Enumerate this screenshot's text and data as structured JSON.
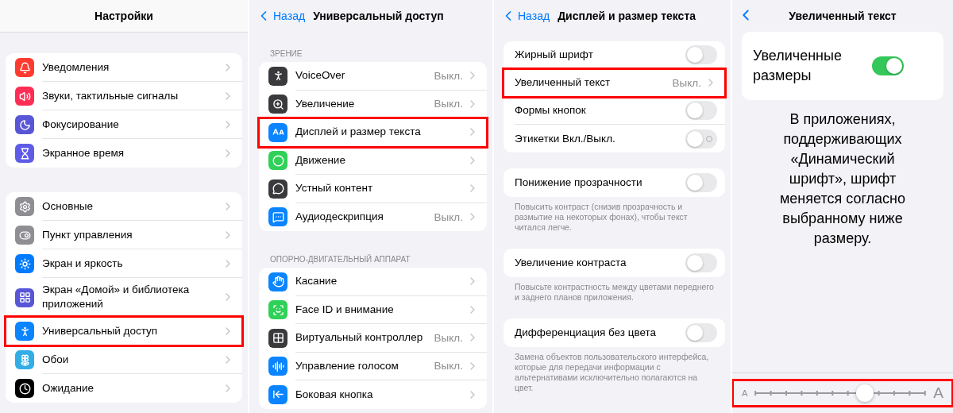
{
  "panels": [
    {
      "kind": "list",
      "title": "Настройки",
      "groups": [
        {
          "items": [
            {
              "kind": "nav",
              "label": "Уведомления",
              "color": "#ff3b30",
              "highlighted": false
            },
            {
              "kind": "nav",
              "label": "Звуки, тактильные сигналы",
              "color": "#ff2d55",
              "highlighted": false
            },
            {
              "kind": "nav",
              "label": "Фокусирование",
              "color": "#5856d6",
              "highlighted": false
            },
            {
              "kind": "nav",
              "label": "Экранное время",
              "color": "#5e5ce6",
              "highlighted": false
            }
          ]
        },
        {
          "items": [
            {
              "kind": "nav",
              "label": "Основные",
              "color": "#8e8e93",
              "highlighted": false
            },
            {
              "kind": "nav",
              "label": "Пункт управления",
              "color": "#8e8e93",
              "highlighted": false
            },
            {
              "kind": "nav",
              "label": "Экран и яркость",
              "color": "#007aff",
              "highlighted": false
            },
            {
              "kind": "nav",
              "label": "Экран «Домой» и библиотека приложений",
              "color": "#5856d6",
              "highlighted": false
            },
            {
              "kind": "nav",
              "label": "Универсальный доступ",
              "color": "#0a84ff",
              "highlighted": true
            },
            {
              "kind": "nav",
              "label": "Обои",
              "color": "#32ade6",
              "highlighted": false
            },
            {
              "kind": "nav",
              "label": "Ожидание",
              "color": "#000000",
              "highlighted": false
            }
          ]
        }
      ]
    },
    {
      "kind": "list",
      "back": "Назад",
      "title": "Универсальный доступ",
      "groups": [
        {
          "header": "ЗРЕНИЕ",
          "items": [
            {
              "kind": "nav",
              "label": "VoiceOver",
              "value": "Выкл.",
              "color": "#3a3a3c",
              "highlighted": false
            },
            {
              "kind": "nav",
              "label": "Увеличение",
              "value": "Выкл.",
              "color": "#3a3a3c",
              "highlighted": false
            },
            {
              "kind": "nav",
              "label": "Дисплей и размер текста",
              "color": "#0a84ff",
              "highlighted": true
            },
            {
              "kind": "nav",
              "label": "Движение",
              "color": "#30d158",
              "highlighted": false
            },
            {
              "kind": "nav",
              "label": "Устный контент",
              "color": "#3a3a3c",
              "highlighted": false
            },
            {
              "kind": "nav",
              "label": "Аудиодескрипция",
              "value": "Выкл.",
              "color": "#0a84ff",
              "highlighted": false
            }
          ]
        },
        {
          "header": "ОПОРНО-ДВИГАТЕЛЬНЫЙ АППАРАТ",
          "items": [
            {
              "kind": "nav",
              "label": "Касание",
              "color": "#0a84ff",
              "highlighted": false
            },
            {
              "kind": "nav",
              "label": "Face ID и внимание",
              "color": "#30d158",
              "highlighted": false
            },
            {
              "kind": "nav",
              "label": "Виртуальный контроллер",
              "value": "Выкл.",
              "color": "#3a3a3c",
              "highlighted": false
            },
            {
              "kind": "nav",
              "label": "Управление голосом",
              "value": "Выкл.",
              "color": "#0a84ff",
              "highlighted": false
            },
            {
              "kind": "nav",
              "label": "Боковая кнопка",
              "color": "#0a84ff",
              "highlighted": false
            }
          ]
        }
      ]
    },
    {
      "kind": "list",
      "back": "Назад",
      "title": "Дисплей и размер текста",
      "groups": [
        {
          "items": [
            {
              "kind": "toggle",
              "label": "Жирный шрифт",
              "on": false,
              "off_mark": false,
              "highlighted": false
            },
            {
              "kind": "link",
              "label": "Увеличенный текст",
              "value": "Выкл.",
              "highlighted": true
            },
            {
              "kind": "toggle",
              "label": "Формы кнопок",
              "on": false,
              "off_mark": false,
              "highlighted": false
            },
            {
              "kind": "toggle",
              "label": "Этикетки Вкл./Выкл.",
              "on": false,
              "off_mark": true,
              "highlighted": false
            }
          ]
        },
        {
          "items": [
            {
              "kind": "toggle",
              "label": "Понижение прозрачности",
              "on": false,
              "off_mark": false,
              "highlighted": false
            }
          ],
          "footer": "Повысить контраст (снизив прозрачность и размытие на некоторых фонах), чтобы текст читался легче."
        },
        {
          "items": [
            {
              "kind": "toggle",
              "label": "Увеличение контраста",
              "on": false,
              "off_mark": false,
              "highlighted": false
            }
          ],
          "footer": "Повысьте контрастность между цветами переднего и заднего планов приложения."
        },
        {
          "items": [
            {
              "kind": "toggle",
              "label": "Дифференциация без цвета",
              "on": false,
              "off_mark": false,
              "highlighted": false
            }
          ],
          "footer": "Замена объектов пользовательского интерфейса, которые для передачи информации с альтернативами исключительно полагаются на цвет."
        }
      ]
    },
    {
      "kind": "detail",
      "title": "Увеличенный текст",
      "card": {
        "label": "Увеличенные размеры",
        "on": true
      },
      "description": "В приложениях, поддерживающих «Динамический шрифт», шрифт меняется согласно выбранному ниже размеру.",
      "slider": {
        "min_label": "A",
        "max_label": "A",
        "level": 0.64,
        "highlighted": true
      }
    }
  ]
}
